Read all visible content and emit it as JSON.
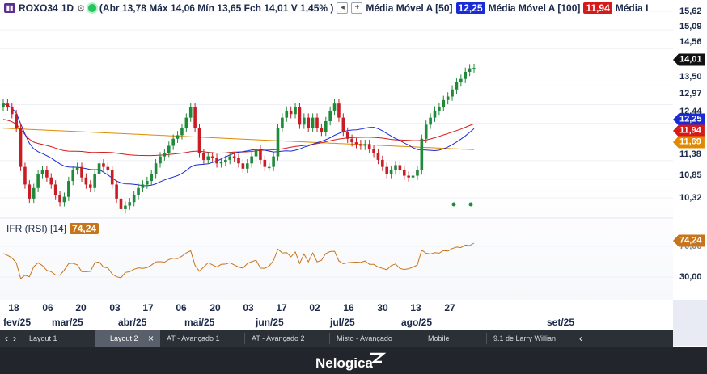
{
  "header": {
    "symbol": "ROXO34",
    "timeframe": "1D",
    "quote_text": "(Abr 13,78 Máx 14,06 Mín 13,65 Fch 14,01 V 1,45% )",
    "ma50_label": "Média Móvel A [50]",
    "ma50_value": "12,25",
    "ma100_label": "Média Móvel A [100]",
    "ma100_value": "11,94",
    "ma200_label": "Média I"
  },
  "colors": {
    "up": "#1f8a3a",
    "down": "#c81d25",
    "ma50": "#1a2bd6",
    "ma100": "#d61a1a",
    "ma200": "#e08a00",
    "rsi": "#c8741a",
    "price_tag": "#111111"
  },
  "price_axis": {
    "ticks": [
      "15,62",
      "15,09",
      "14,56",
      "13,50",
      "12,97",
      "12,44",
      "11,38",
      "10,85",
      "10,32"
    ],
    "last_price": "14,01",
    "ma50": "12,25",
    "ma100": "11,94",
    "ma200": "11,69",
    "rsi_value": "74,24",
    "rsi_ticks": [
      "70,00",
      "30,00"
    ]
  },
  "rsi": {
    "label": "IFR (RSI) [14]",
    "value": "74,24"
  },
  "time_axis": {
    "days": [
      "18",
      "06",
      "20",
      "03",
      "17",
      "06",
      "20",
      "03",
      "17",
      "02",
      "16",
      "30",
      "13",
      "27"
    ],
    "months": [
      "fev/25",
      "mar/25",
      "abr/25",
      "mai/25",
      "jun/25",
      "jul/25",
      "ago/25",
      "set/25"
    ]
  },
  "tabs": {
    "items": [
      "Layout 1",
      "Layout 2",
      "AT - Avançado 1",
      "AT - Avançado 2",
      "Misto - Avançado",
      "Mobile",
      "9.1 de Larry Willian"
    ],
    "active": "Layout 2",
    "close_glyph": "×"
  },
  "chart_data": {
    "type": "candlestick",
    "price_close_series": [
      13.0,
      12.9,
      12.7,
      12.3,
      11.2,
      10.7,
      10.3,
      10.6,
      11.0,
      11.1,
      10.9,
      10.7,
      10.4,
      10.2,
      10.35,
      10.8,
      11.1,
      11.2,
      10.9,
      10.7,
      10.6,
      11.0,
      11.3,
      11.2,
      11.1,
      10.7,
      10.3,
      10.0,
      10.1,
      10.2,
      10.4,
      10.6,
      10.7,
      10.8,
      11.0,
      11.3,
      11.5,
      11.6,
      11.8,
      12.0,
      12.1,
      12.3,
      12.6,
      12.9,
      12.3,
      11.6,
      11.4,
      11.5,
      11.45,
      11.3,
      11.35,
      11.4,
      11.5,
      11.45,
      11.3,
      11.15,
      11.3,
      11.5,
      11.7,
      11.4,
      11.2,
      11.2,
      11.5,
      12.3,
      12.6,
      12.8,
      12.7,
      12.9,
      12.4,
      12.6,
      12.3,
      12.6,
      12.3,
      12.2,
      12.5,
      12.8,
      13.0,
      12.6,
      12.2,
      12.0,
      11.9,
      11.85,
      11.8,
      11.85,
      11.7,
      11.6,
      11.4,
      11.2,
      11.0,
      11.1,
      11.25,
      11.1,
      10.95,
      10.9,
      10.95,
      11.1,
      12.0,
      12.4,
      12.6,
      12.8,
      12.9,
      13.1,
      13.2,
      13.4,
      13.6,
      13.7,
      13.9,
      14.0,
      14.01
    ],
    "ma50_value": 12.25,
    "ma100_value": 11.94,
    "ma200_value": 11.69,
    "last_close": 14.01,
    "rsi_last": 74.24,
    "y_ticks": [
      15.62,
      15.09,
      14.56,
      13.5,
      12.97,
      12.44,
      11.38,
      10.85,
      10.32
    ],
    "rsi_levels": [
      70,
      30
    ]
  }
}
